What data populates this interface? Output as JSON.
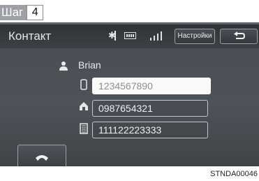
{
  "step": {
    "word": "Шаг",
    "number": "4"
  },
  "header": {
    "title": "Контакт",
    "settings_label": "Настройки"
  },
  "status_icons": [
    "bluetooth-icon",
    "battery-icon",
    "signal-strength-icon"
  ],
  "contact": {
    "name": "Brian",
    "numbers": [
      {
        "type": "mobile-phone-icon",
        "value": "1234567890",
        "selected": true
      },
      {
        "type": "home-icon",
        "value": "0987654321",
        "selected": false
      },
      {
        "type": "office-icon",
        "value": "111122223333",
        "selected": false
      }
    ]
  },
  "buttons": [
    "back-arrow-icon",
    "call-handset-icon"
  ],
  "figure_code": "STNDA00046",
  "colors": {
    "screen": "#4d5359",
    "selected_field": "#fafafa",
    "text": "#e7eaed"
  }
}
